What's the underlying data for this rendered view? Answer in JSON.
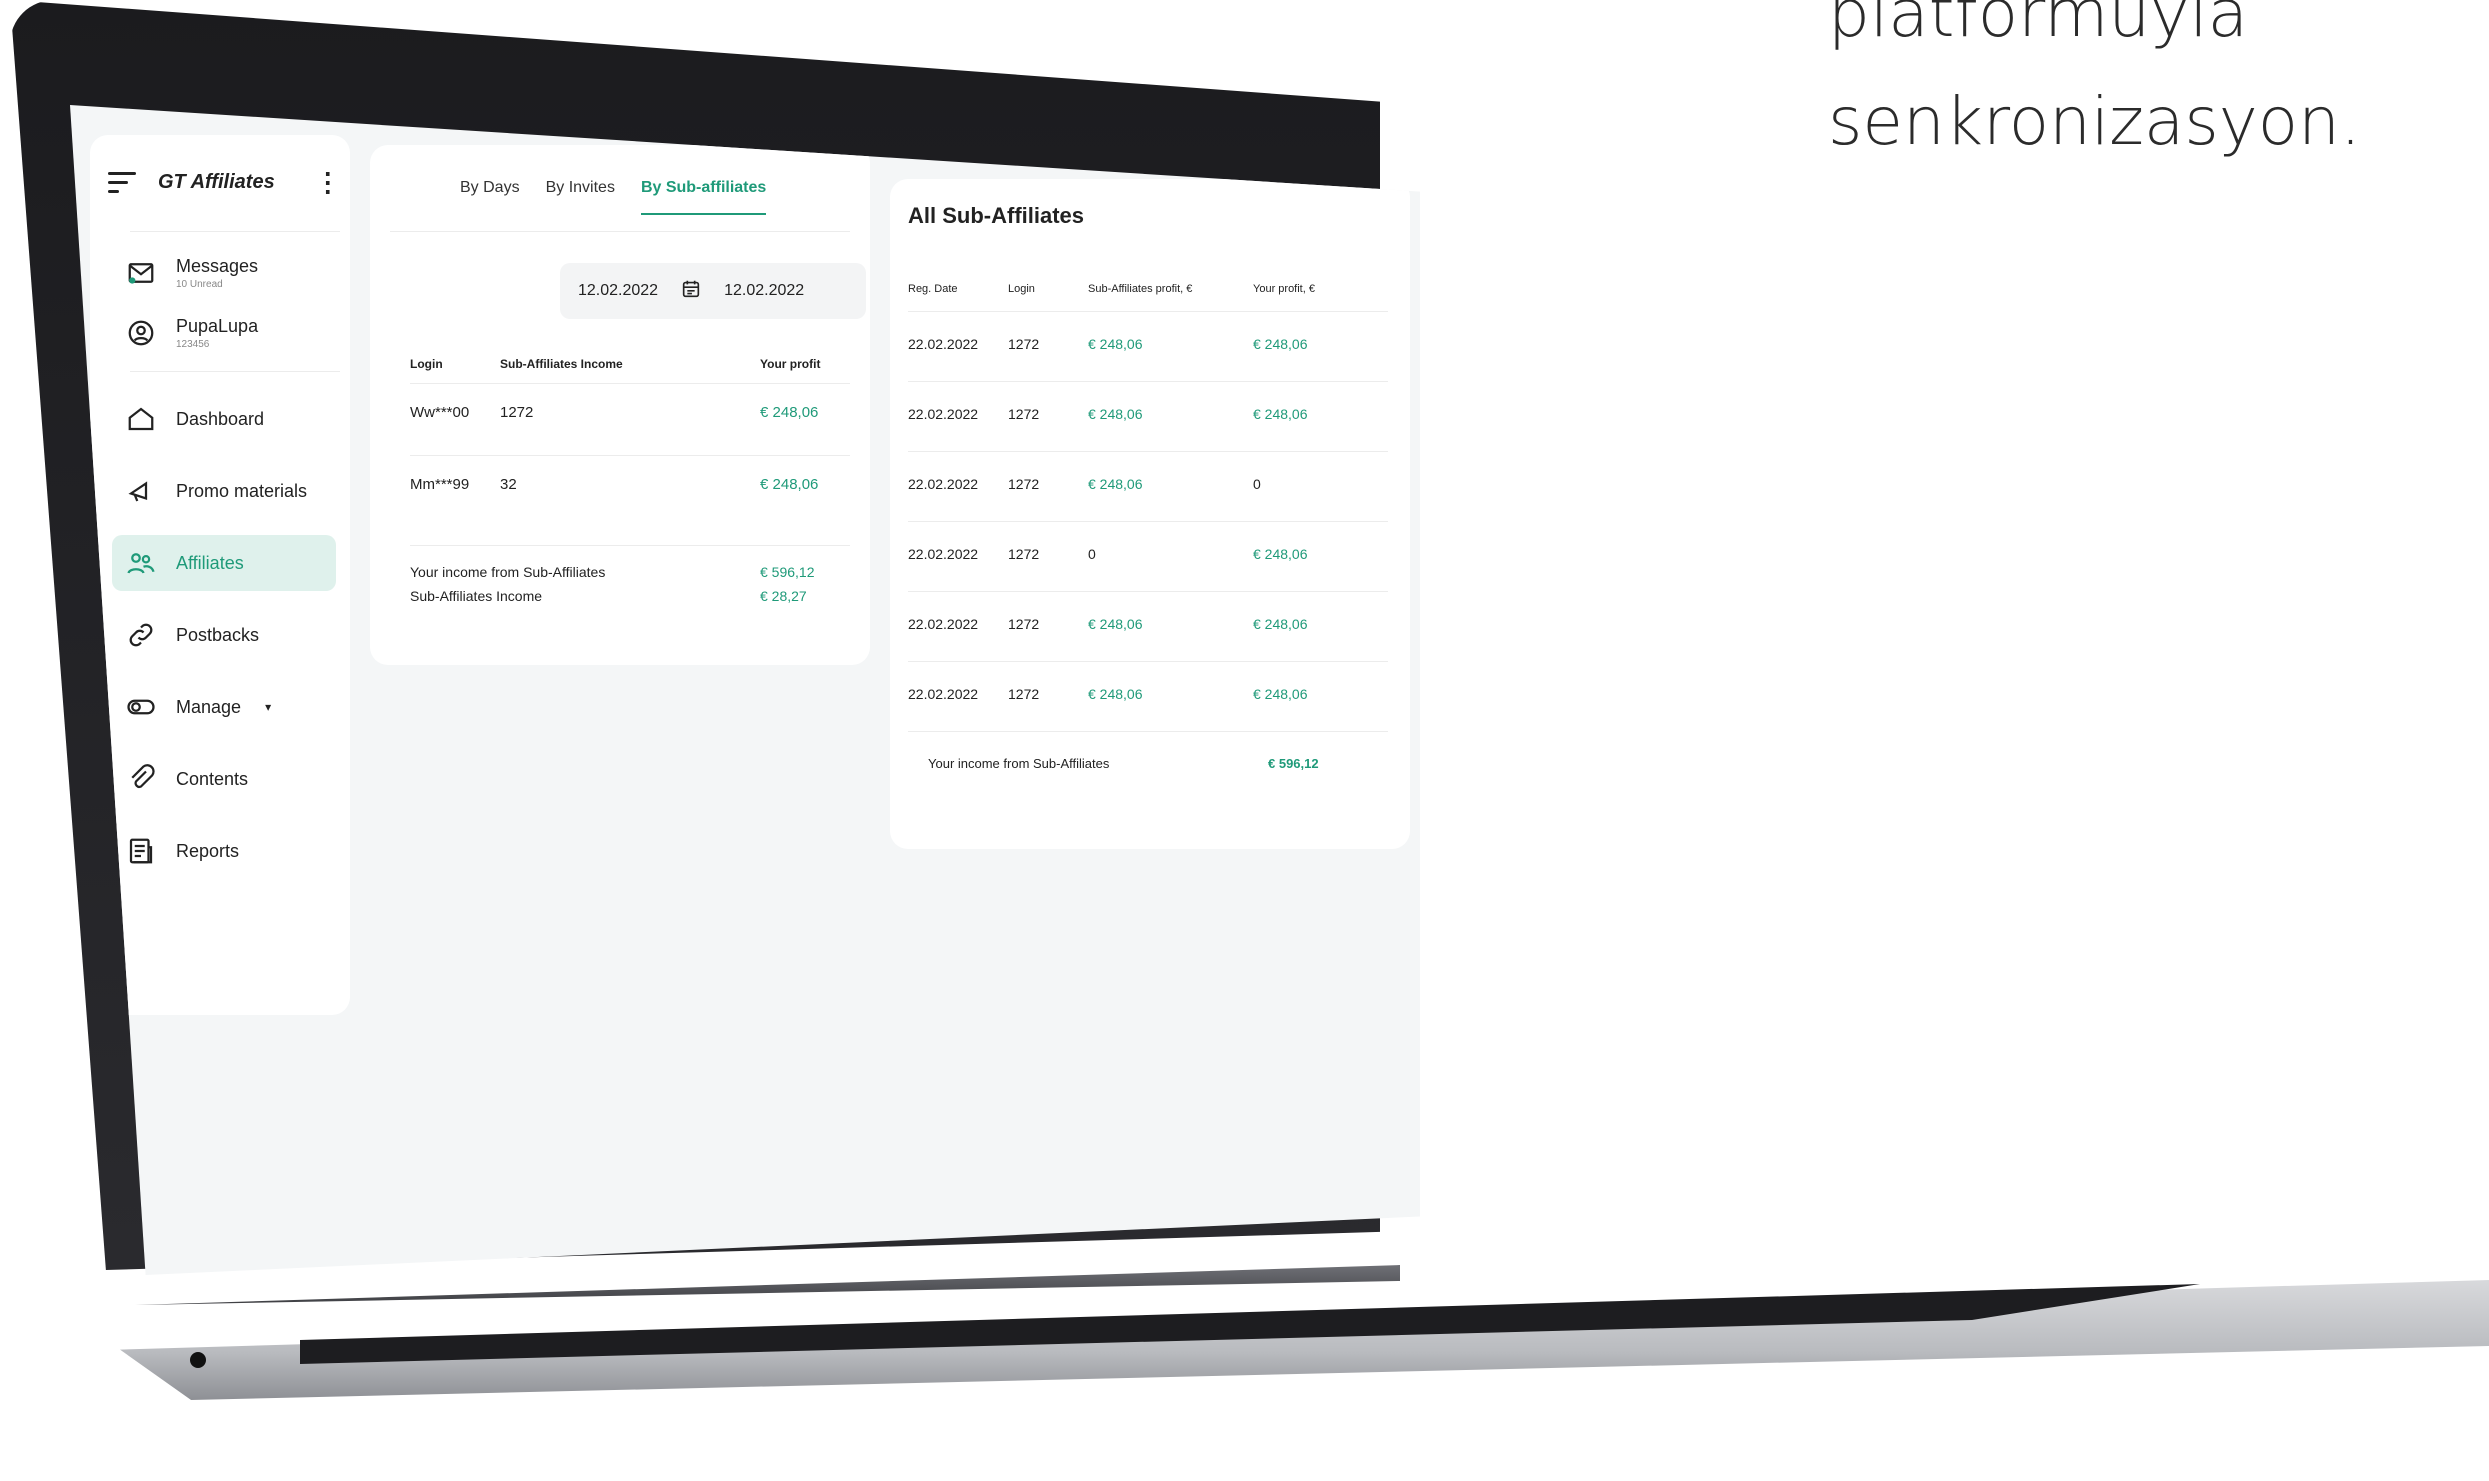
{
  "hero": {
    "line1": "platformuyla",
    "line2": "senkronizasyon."
  },
  "colors": {
    "accent": "#1f9a79",
    "active_bg": "#dff1ec"
  },
  "sidebar": {
    "brand": "GT Affiliates",
    "menu_icon": "hamburger-icon",
    "more_icon": "kebab-icon",
    "messages": {
      "label": "Messages",
      "sub": "10 Unread",
      "icon": "mail-icon"
    },
    "profile": {
      "label": "PupaLupa",
      "sub": "123456",
      "icon": "user-icon"
    },
    "items": [
      {
        "label": "Dashboard",
        "icon": "home-icon"
      },
      {
        "label": "Promo materials",
        "icon": "megaphone-icon"
      },
      {
        "label": "Affiliates",
        "icon": "users-icon",
        "active": true
      },
      {
        "label": "Postbacks",
        "icon": "link-icon"
      },
      {
        "label": "Manage",
        "icon": "toggle-icon"
      },
      {
        "label": "Contents",
        "icon": "paperclip-icon"
      },
      {
        "label": "Reports",
        "icon": "report-icon"
      }
    ]
  },
  "center": {
    "tabs": [
      "By Days",
      "By Invites",
      "By Sub-affiliates"
    ],
    "active_tab": "By Sub-affiliates",
    "date_from": "12.02.2022",
    "date_to": "12.02.2022",
    "columns": [
      "Login",
      "Sub-Affiliates Income",
      "Your profit"
    ],
    "rows": [
      {
        "login": "Ww***00",
        "income": "1272",
        "profit": "€ 248,06"
      },
      {
        "login": "Mm***99",
        "income": "32",
        "profit": "€ 248,06"
      }
    ],
    "summary": [
      {
        "label": "Your income from Sub-Affiliates",
        "value": "€ 596,12"
      },
      {
        "label": "Sub-Affiliates Income",
        "value": "€ 28,27"
      }
    ]
  },
  "right": {
    "title": "All Sub-Affiliates",
    "columns": [
      "Reg. Date",
      "Login",
      "Sub-Affiliates profit, €",
      "Your profit, €"
    ],
    "rows": [
      {
        "date": "22.02.2022",
        "login": "1272",
        "sub_profit": "€ 248,06",
        "your_profit": "€ 248,06"
      },
      {
        "date": "22.02.2022",
        "login": "1272",
        "sub_profit": "€ 248,06",
        "your_profit": "€ 248,06"
      },
      {
        "date": "22.02.2022",
        "login": "1272",
        "sub_profit": "€ 248,06",
        "your_profit": "0"
      },
      {
        "date": "22.02.2022",
        "login": "1272",
        "sub_profit": "0",
        "your_profit": "€ 248,06"
      },
      {
        "date": "22.02.2022",
        "login": "1272",
        "sub_profit": "€ 248,06",
        "your_profit": "€ 248,06"
      },
      {
        "date": "22.02.2022",
        "login": "1272",
        "sub_profit": "€ 248,06",
        "your_profit": "€ 248,06"
      }
    ],
    "summary": {
      "label": "Your income from Sub-Affiliates",
      "value": "€ 596,12"
    }
  }
}
